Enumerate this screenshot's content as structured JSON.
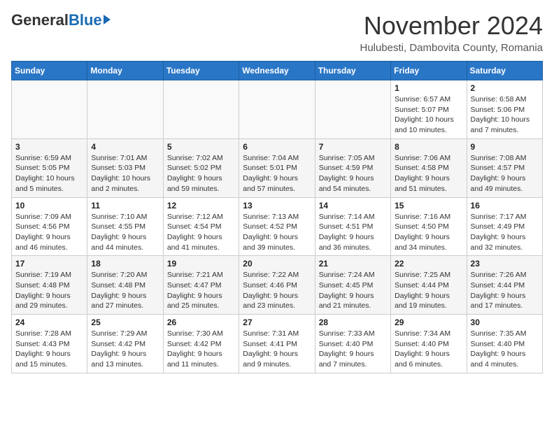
{
  "header": {
    "logo_general": "General",
    "logo_blue": "Blue",
    "month_title": "November 2024",
    "location": "Hulubesti, Dambovita County, Romania"
  },
  "calendar": {
    "days_of_week": [
      "Sunday",
      "Monday",
      "Tuesday",
      "Wednesday",
      "Thursday",
      "Friday",
      "Saturday"
    ],
    "rows": [
      [
        {
          "day": "",
          "info": ""
        },
        {
          "day": "",
          "info": ""
        },
        {
          "day": "",
          "info": ""
        },
        {
          "day": "",
          "info": ""
        },
        {
          "day": "",
          "info": ""
        },
        {
          "day": "1",
          "info": "Sunrise: 6:57 AM\nSunset: 5:07 PM\nDaylight: 10 hours and 10 minutes."
        },
        {
          "day": "2",
          "info": "Sunrise: 6:58 AM\nSunset: 5:06 PM\nDaylight: 10 hours and 7 minutes."
        }
      ],
      [
        {
          "day": "3",
          "info": "Sunrise: 6:59 AM\nSunset: 5:05 PM\nDaylight: 10 hours and 5 minutes."
        },
        {
          "day": "4",
          "info": "Sunrise: 7:01 AM\nSunset: 5:03 PM\nDaylight: 10 hours and 2 minutes."
        },
        {
          "day": "5",
          "info": "Sunrise: 7:02 AM\nSunset: 5:02 PM\nDaylight: 9 hours and 59 minutes."
        },
        {
          "day": "6",
          "info": "Sunrise: 7:04 AM\nSunset: 5:01 PM\nDaylight: 9 hours and 57 minutes."
        },
        {
          "day": "7",
          "info": "Sunrise: 7:05 AM\nSunset: 4:59 PM\nDaylight: 9 hours and 54 minutes."
        },
        {
          "day": "8",
          "info": "Sunrise: 7:06 AM\nSunset: 4:58 PM\nDaylight: 9 hours and 51 minutes."
        },
        {
          "day": "9",
          "info": "Sunrise: 7:08 AM\nSunset: 4:57 PM\nDaylight: 9 hours and 49 minutes."
        }
      ],
      [
        {
          "day": "10",
          "info": "Sunrise: 7:09 AM\nSunset: 4:56 PM\nDaylight: 9 hours and 46 minutes."
        },
        {
          "day": "11",
          "info": "Sunrise: 7:10 AM\nSunset: 4:55 PM\nDaylight: 9 hours and 44 minutes."
        },
        {
          "day": "12",
          "info": "Sunrise: 7:12 AM\nSunset: 4:54 PM\nDaylight: 9 hours and 41 minutes."
        },
        {
          "day": "13",
          "info": "Sunrise: 7:13 AM\nSunset: 4:52 PM\nDaylight: 9 hours and 39 minutes."
        },
        {
          "day": "14",
          "info": "Sunrise: 7:14 AM\nSunset: 4:51 PM\nDaylight: 9 hours and 36 minutes."
        },
        {
          "day": "15",
          "info": "Sunrise: 7:16 AM\nSunset: 4:50 PM\nDaylight: 9 hours and 34 minutes."
        },
        {
          "day": "16",
          "info": "Sunrise: 7:17 AM\nSunset: 4:49 PM\nDaylight: 9 hours and 32 minutes."
        }
      ],
      [
        {
          "day": "17",
          "info": "Sunrise: 7:19 AM\nSunset: 4:48 PM\nDaylight: 9 hours and 29 minutes."
        },
        {
          "day": "18",
          "info": "Sunrise: 7:20 AM\nSunset: 4:48 PM\nDaylight: 9 hours and 27 minutes."
        },
        {
          "day": "19",
          "info": "Sunrise: 7:21 AM\nSunset: 4:47 PM\nDaylight: 9 hours and 25 minutes."
        },
        {
          "day": "20",
          "info": "Sunrise: 7:22 AM\nSunset: 4:46 PM\nDaylight: 9 hours and 23 minutes."
        },
        {
          "day": "21",
          "info": "Sunrise: 7:24 AM\nSunset: 4:45 PM\nDaylight: 9 hours and 21 minutes."
        },
        {
          "day": "22",
          "info": "Sunrise: 7:25 AM\nSunset: 4:44 PM\nDaylight: 9 hours and 19 minutes."
        },
        {
          "day": "23",
          "info": "Sunrise: 7:26 AM\nSunset: 4:44 PM\nDaylight: 9 hours and 17 minutes."
        }
      ],
      [
        {
          "day": "24",
          "info": "Sunrise: 7:28 AM\nSunset: 4:43 PM\nDaylight: 9 hours and 15 minutes."
        },
        {
          "day": "25",
          "info": "Sunrise: 7:29 AM\nSunset: 4:42 PM\nDaylight: 9 hours and 13 minutes."
        },
        {
          "day": "26",
          "info": "Sunrise: 7:30 AM\nSunset: 4:42 PM\nDaylight: 9 hours and 11 minutes."
        },
        {
          "day": "27",
          "info": "Sunrise: 7:31 AM\nSunset: 4:41 PM\nDaylight: 9 hours and 9 minutes."
        },
        {
          "day": "28",
          "info": "Sunrise: 7:33 AM\nSunset: 4:40 PM\nDaylight: 9 hours and 7 minutes."
        },
        {
          "day": "29",
          "info": "Sunrise: 7:34 AM\nSunset: 4:40 PM\nDaylight: 9 hours and 6 minutes."
        },
        {
          "day": "30",
          "info": "Sunrise: 7:35 AM\nSunset: 4:40 PM\nDaylight: 9 hours and 4 minutes."
        }
      ]
    ]
  }
}
